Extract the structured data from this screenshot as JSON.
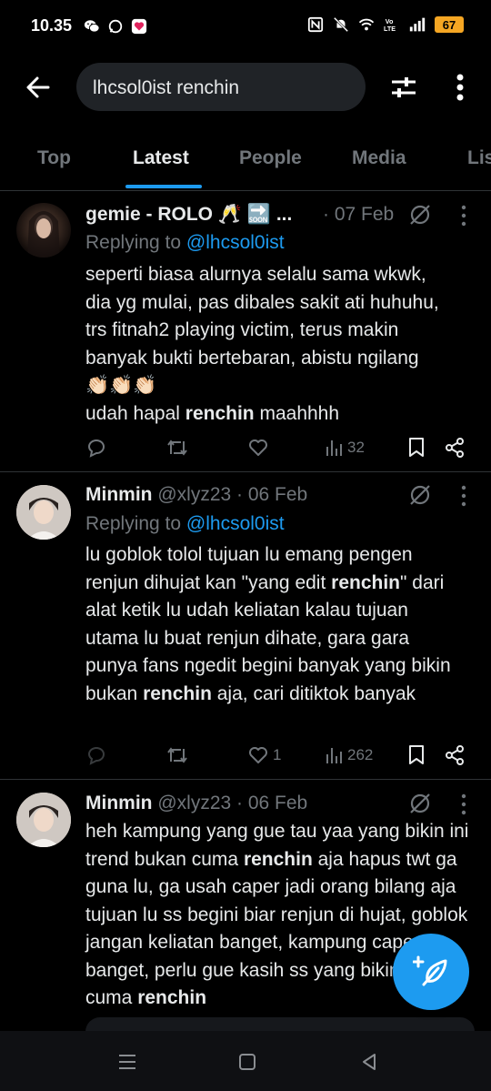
{
  "status_bar": {
    "time": "10.35",
    "battery": "67",
    "icons_left": [
      "wechat-icon",
      "chat-bubble-icon",
      "app-notification-icon"
    ],
    "icons_right": [
      "nfc-icon",
      "mute-icon",
      "wifi-icon",
      "volte-icon",
      "signal-icon",
      "battery-icon"
    ]
  },
  "header": {
    "search_value": "lhcsol0ist renchin"
  },
  "tabs": [
    {
      "label": "Top",
      "active": false
    },
    {
      "label": "Latest",
      "active": true
    },
    {
      "label": "People",
      "active": false
    },
    {
      "label": "Media",
      "active": false
    },
    {
      "label": "Lis",
      "active": false
    }
  ],
  "tweets": [
    {
      "name": "gemie - ROLO 🥂 🔜 ...",
      "handle": "",
      "date": "· 07 Feb",
      "replying_prefix": "Replying to ",
      "replying_to": "@lhcsol0ist",
      "lines": [
        "seperti biasa alurnya selalu sama wkwk,",
        "dia yg mulai, pas dibales sakit ati huhuhu,",
        "trs fitnah2 playing victim, terus makin",
        "banyak bukti bertebaran, abistu ngilang",
        "👏🏻👏🏻👏🏻",
        "udah hapal ",
        "renchin",
        " maahhhh"
      ],
      "actions": {
        "reply": "",
        "retweet": "",
        "like": "",
        "views": "32"
      }
    },
    {
      "name": "Minmin",
      "handle": "@xlyz23",
      "date": "· 06 Feb",
      "replying_prefix": "Replying to ",
      "replying_to": "@lhcsol0ist",
      "text_parts": [
        "lu goblok tolol tujuan lu emang pengen renjun dihujat kan \"yang edit ",
        "renchin",
        "\" dari alat ketik lu udah keliatan kalau tujuan utama lu buat renjun dihate, gara gara punya fans ngedit begini banyak yang bikin bukan ",
        "renchin",
        " aja, cari ditiktok banyak"
      ],
      "actions": {
        "reply": "",
        "retweet": "",
        "like": "1",
        "views": "262"
      }
    },
    {
      "name": "Minmin",
      "handle": "@xlyz23",
      "date": "· 06 Feb",
      "text_parts": [
        "heh kampung yang gue tau yaa yang bikin ini trend bukan cuma ",
        "renchin",
        " aja hapus twt ga guna lu, ga usah caper jadi orang bilang aja tujuan lu ss begini biar renjun di hujat, goblok jangan keliatan banget, kampung caper banget, perlu gue kasih ss yang bikin bukan cuma ",
        "renchin"
      ]
    }
  ],
  "colors": {
    "accent": "#1d9bf0",
    "muted": "#71767b",
    "text": "#e7e9ea",
    "background": "#000000"
  }
}
